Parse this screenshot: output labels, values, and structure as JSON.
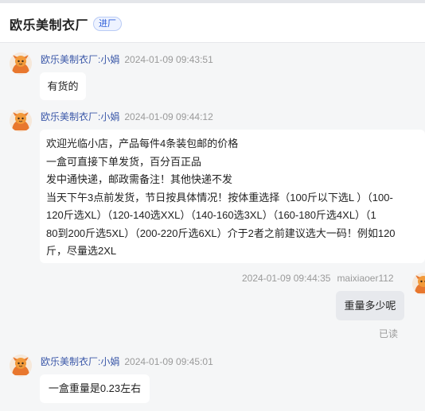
{
  "header": {
    "shop_name": "欧乐美制衣厂",
    "badge": "进厂"
  },
  "messages": [
    {
      "sender": "欧乐美制衣厂:小娟",
      "time": "2024-01-09 09:43:51",
      "text": "有货的"
    },
    {
      "sender": "欧乐美制衣厂:小娟",
      "time": "2024-01-09 09:44:12",
      "lines": [
        "欢迎光临小店，产品每件4条装包邮的价格",
        "一盒可直接下单发货，百分百正品",
        "发中通快递，邮政需备注！其他快递不发",
        "当天下午3点前发货，节日按具体情况！按体重选择（100斤以下选L ）（100-",
        "120斤选XL）（120-140选XXL）（140-160选3XL）（160-180斤选4XL）（1",
        "80到200斤选5XL）（200-220斤选6XL）介于2者之前建议选大一码！例如120",
        "斤，尽量选2XL"
      ]
    },
    {
      "time": "2024-01-09 09:44:35",
      "sender": "maixiaoer112",
      "text": "重量多少呢",
      "status": "已读"
    },
    {
      "sender": "欧乐美制衣厂:小娟",
      "time": "2024-01-09 09:45:01",
      "text": "一盒重量是0.23左右"
    }
  ],
  "colors": {
    "background": "#f5f6f7",
    "sender_name": "#3a57a8",
    "badge": "#2a5bd7",
    "self_bubble": "#e7e9ed"
  },
  "icons": {
    "seller_avatar": "orange-mascot-avatar",
    "buyer_avatar": "orange-mascot-avatar"
  }
}
